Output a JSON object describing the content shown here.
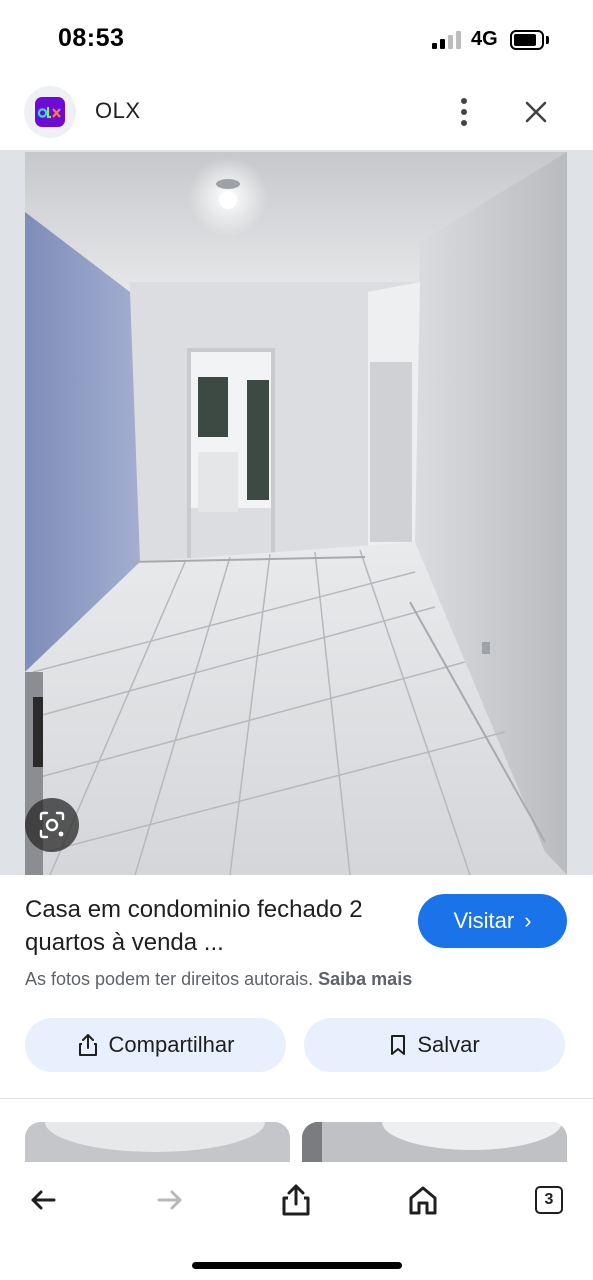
{
  "status_bar": {
    "time": "08:53",
    "network": "4G"
  },
  "header": {
    "site_name": "OLX",
    "logo_icon": "olx-logo",
    "menu_icon": "more-vert-icon",
    "close_icon": "close-icon"
  },
  "result": {
    "title": "Casa em condominio fechado 2 quartos à venda ...",
    "visit_label": "Visitar",
    "copyright_text": "As fotos podem ter direitos autorais.",
    "learn_more": "Saiba mais"
  },
  "actions": {
    "share_label": "Compartilhar",
    "save_label": "Salvar"
  },
  "toolbar": {
    "tabs_count": "3"
  },
  "colors": {
    "accent": "#1a73e8",
    "chip_bg": "#e8f0fe",
    "olx_purple": "#6e0ad6"
  }
}
